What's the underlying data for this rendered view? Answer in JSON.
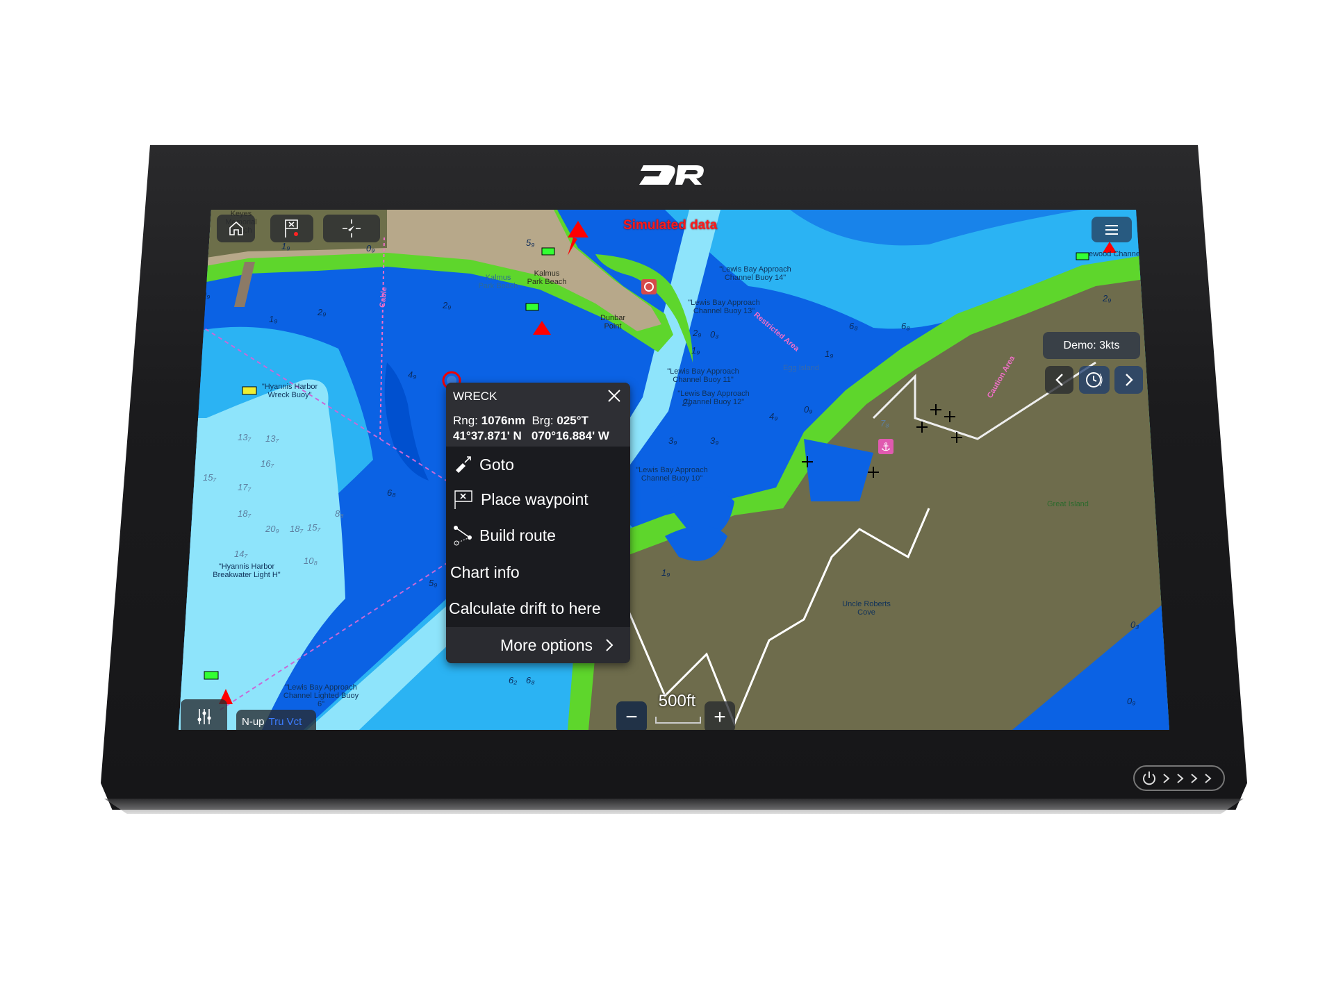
{
  "banner": "Simulated data",
  "toolbar": {
    "home_icon": "home-icon",
    "waypoint_icon": "flag-waypoint-icon",
    "boat_icon": "boat-center-icon",
    "menu_icon": "hamburger-menu-icon"
  },
  "demo": {
    "label": "Demo: 3kts",
    "prev_icon": "chevron-left-icon",
    "timer_icon": "clock-icon",
    "next_icon": "chevron-right-icon"
  },
  "bottom": {
    "orientation": "N-up",
    "motion": "Tru Vct",
    "scale": "500ft",
    "zoom_out": "−",
    "zoom_in": "+"
  },
  "popup": {
    "title": "WRECK",
    "rng_label": "Rng:",
    "rng_value": "1076nm",
    "brg_label": "Brg:",
    "brg_value": "025°T",
    "lat": "41°37.871' N",
    "lon": "070°16.884' W",
    "items": [
      {
        "label": "Goto",
        "icon": "goto-icon"
      },
      {
        "label": "Place waypoint",
        "icon": "waypoint-flag-icon"
      },
      {
        "label": "Build route",
        "icon": "route-icon"
      },
      {
        "label": "Chart info"
      },
      {
        "label": "Calculate drift to here"
      }
    ],
    "more": "More options"
  },
  "map_labels": {
    "keyes": "Keyes Memorial Beach",
    "kalmus1": "Kalmus Park Beach",
    "kalmus2": "Kalmus Park Beach",
    "dunbar": "Dunbar Point",
    "buoy14": "\"Lewis Bay Approach Channel Buoy 14\"",
    "buoy13": "\"Lewis Bay Approach Channel Buoy 13\"",
    "buoy11": "\"Lewis Bay Approach Channel Buoy 11\"",
    "buoy12": "\"Lewis Bay Approach Channel Buoy 12\"",
    "buoy10": "\"Lewis Bay Approach Channel Buoy 10\"",
    "wreck_buoy": "\"Hyannis Harbor Wreck Buoy\"",
    "breakwater": "\"Hyannis Harbor Breakwater Light H\"",
    "buoy6": "\"Lewis Bay Approach Channel Lighted Buoy 6\"",
    "lewood": "ewood Channel Buoy",
    "uncle": "Uncle Roberts Cove",
    "great_island": "Great Island",
    "egg": "Egg Island",
    "restricted": "Restricted Area",
    "caution": "Caution Area",
    "cable": "Cable"
  },
  "soundings": [
    "0₉",
    "1₉",
    "0₉",
    "2₉",
    "1₉",
    "4₉",
    "5₉",
    "2₉",
    "6₈",
    "13₇",
    "13₇",
    "16₇",
    "15₇",
    "17₇",
    "18₇",
    "14₇",
    "20₉",
    "18₇",
    "15₇",
    "10₈",
    "8₈",
    "2₉",
    "0₃",
    "1₉",
    "6₈",
    "6₈",
    "1₉",
    "4₉",
    "3₉",
    "0₉",
    "2₉",
    "3₉",
    "1₉",
    "6₂",
    "6₈",
    "5₉",
    "0₃",
    "0₉",
    "2₉",
    "7₈"
  ],
  "colors": {
    "deep_water": "#0b62e4",
    "shallow_water": "#2bb3f3",
    "very_shallow": "#8ee4fb",
    "intertidal": "#5ed62c",
    "land": "#6e6c4c",
    "banner": "#ff1a1a",
    "panel": "#2e2f34"
  }
}
